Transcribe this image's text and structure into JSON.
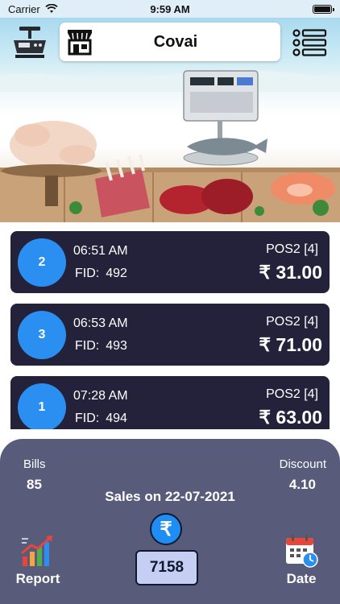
{
  "status_bar": {
    "carrier": "Carrier",
    "time": "9:59 AM"
  },
  "header": {
    "store_name": "Covai",
    "left_icon": "weighing-scale-icon",
    "store_icon": "store-icon",
    "menu_icon": "list-menu-icon"
  },
  "transactions": [
    {
      "number": "2",
      "time": "06:51 AM",
      "fid_label": "FID:",
      "fid": "492",
      "pos": "POS2 [4]",
      "amount": "₹ 31.00"
    },
    {
      "number": "3",
      "time": "06:53 AM",
      "fid_label": "FID:",
      "fid": "493",
      "pos": "POS2 [4]",
      "amount": "₹ 71.00"
    },
    {
      "number": "1",
      "time": "07:28 AM",
      "fid_label": "FID:",
      "fid": "494",
      "pos": "POS2 [4]",
      "amount": "₹ 63.00"
    }
  ],
  "summary": {
    "bills_label": "Bills",
    "bills_value": "85",
    "discount_label": "Discount",
    "discount_value": "4.10",
    "sales_title": "Sales on 22-07-2021",
    "currency_symbol": "₹",
    "total_value": "7158",
    "report_label": "Report",
    "date_label": "Date"
  },
  "colors": {
    "card_bg": "#23223a",
    "circle_blue": "#2b8ff2",
    "panel_bg": "#595b7a",
    "total_box_bg": "#c7cef3"
  }
}
